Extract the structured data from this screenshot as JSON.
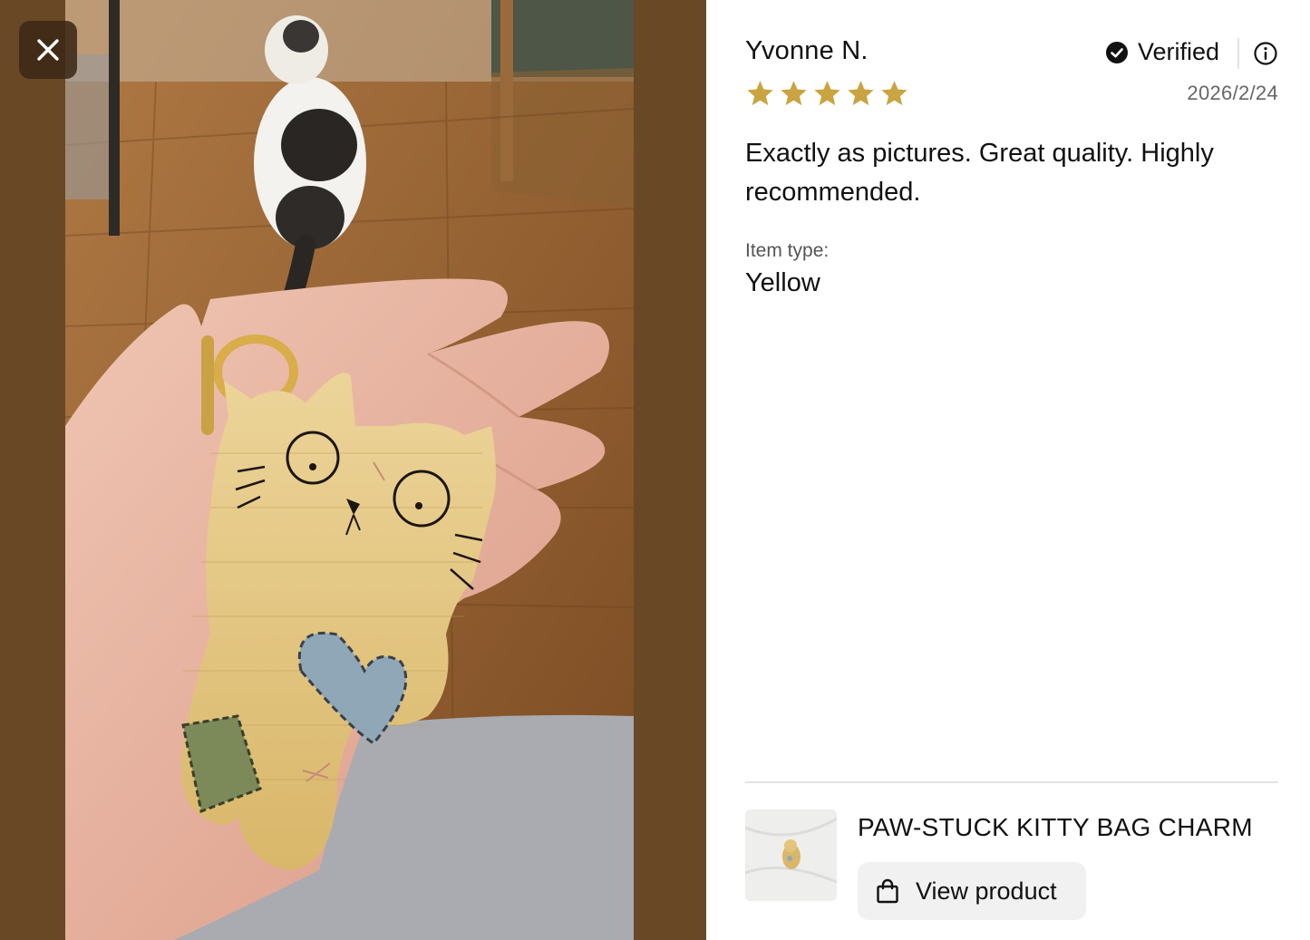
{
  "icons": {
    "close": "close-icon",
    "verified": "verified-check-icon",
    "info": "info-icon",
    "star": "star-icon",
    "bag": "shopping-bag-icon"
  },
  "colors": {
    "media_background": "#694826",
    "star": "#C9A441",
    "verified_badge": "#111111",
    "date_text": "#666666",
    "button_background": "#F1F1F1"
  },
  "review": {
    "reviewer_name": "Yvonne N.",
    "verified_label": "Verified",
    "rating": 5,
    "max_rating": 5,
    "date": "2026/2/24",
    "body": "Exactly as pictures. Great quality. Highly recommended.",
    "item_type_label": "Item type:",
    "item_type_value": "Yellow"
  },
  "product": {
    "title": "PAW-STUCK KITTY BAG CHARM",
    "view_button_label": "View product"
  }
}
